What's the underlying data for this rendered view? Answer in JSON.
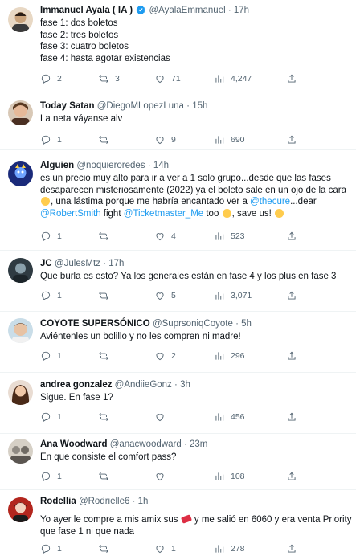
{
  "tweets": [
    {
      "name": "Immanuel Ayala ( IA )",
      "handle": "@AyalaEmmanuel",
      "time": "17h",
      "verified": true,
      "lines": [
        "fase 1: dos boletos",
        "fase 2: tres boletos",
        "fase 3: cuatro boletos",
        "fase 4: hasta agotar existencias"
      ],
      "replies": "2",
      "retweets": "3",
      "likes": "71",
      "views": "4,247",
      "avatar_color": "#c9a27a"
    },
    {
      "name": "Today Satan",
      "handle": "@DiegoMLopezLuna",
      "time": "15h",
      "lines": [
        "La neta váyanse alv"
      ],
      "replies": "1",
      "retweets": "",
      "likes": "9",
      "views": "690",
      "avatar_color": "#7a5a48"
    },
    {
      "name": "Alguien",
      "handle": "@noquieroredes",
      "time": "14h",
      "line1": "es un precio muy alto para ir a ver a 1 solo grupo...desde que las fases",
      "line2": "desaparecen misteriosamente (2022) ya el boleto sale en un ojo de la cara",
      "line3_a": ", una lástima porque me habría encantado ver a ",
      "line3_link": "@thecure",
      "line3_b": "...dear",
      "line4_link1": "@RobertSmith",
      "line4_mid": " fight ",
      "line4_link2": "@Ticketmaster_Me",
      "line4_b": "  too ",
      "line4_c": ", save us! ",
      "replies": "1",
      "retweets": "",
      "likes": "4",
      "views": "523",
      "avatar_color": "#2b3a8f"
    },
    {
      "name": "JC",
      "handle": "@JulesMtz",
      "time": "17h",
      "lines": [
        "Que burla es esto? Ya los generales están en fase 4 y los plus en fase 3"
      ],
      "replies": "1",
      "retweets": "",
      "likes": "5",
      "views": "3,071",
      "avatar_color": "#3d4a52"
    },
    {
      "name": "COYOTE SUPERSÓNICO",
      "handle": "@SuprsoniqCoyote",
      "time": "5h",
      "lines": [
        "Aviéntenles un bolillo y no les compren ni madre!"
      ],
      "replies": "1",
      "retweets": "",
      "likes": "2",
      "views": "296",
      "avatar_color": "#d9b89a"
    },
    {
      "name": "andrea gonzalez",
      "handle": "@AndiieGonz",
      "time": "3h",
      "lines": [
        "Sigue. En fase 1?"
      ],
      "replies": "1",
      "retweets": "",
      "likes": "",
      "views": "456",
      "avatar_color": "#8a5a3c"
    },
    {
      "name": "Ana Woodward",
      "handle": "@anacwoodward",
      "time": "23m",
      "lines": [
        "En que consiste el comfort pass?"
      ],
      "replies": "1",
      "retweets": "",
      "likes": "",
      "views": "108",
      "avatar_color": "#b9b2a8"
    },
    {
      "name": "Rodellia",
      "handle": "@Rodrielle6",
      "time": "1h",
      "line1_a": "Yo ayer le compre a mis amix sus ",
      "line1_b": " y me salió en 6060 y era venta Priority",
      "line2": "que fase 1 ni que nada",
      "replies": "1",
      "retweets": "",
      "likes": "1",
      "views": "278",
      "avatar_color": "#b3261e"
    }
  ]
}
